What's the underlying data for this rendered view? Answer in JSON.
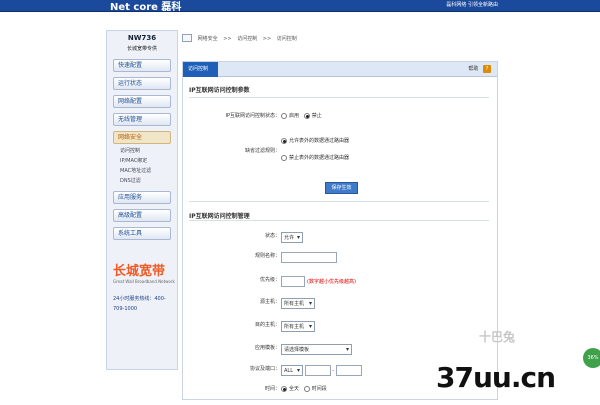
{
  "top": {
    "brand": "Net core 磊科",
    "slogan": "磊科网络 引领全新路由"
  },
  "sidebar": {
    "model": "NW736",
    "subtitle": "长城宽带专供",
    "items": [
      {
        "label": "快速配置"
      },
      {
        "label": "运行状态"
      },
      {
        "label": "网络配置"
      },
      {
        "label": "无线管理"
      },
      {
        "label": "网络安全",
        "active": true
      },
      {
        "label": "应用服务"
      },
      {
        "label": "高级配置"
      },
      {
        "label": "系统工具"
      }
    ],
    "sub_items": [
      "访问控制",
      "IP/MAC绑定",
      "MAC地址过滤",
      "DNS过滤"
    ],
    "logo": {
      "name": "长城宽带",
      "subtitle": "Great Wall Broadband Network"
    },
    "hotline": "24小时服务热线：400-709-1000"
  },
  "breadcrumb": {
    "items": [
      "网络安全",
      ">>",
      "访问控制",
      ">>",
      "访问控制"
    ]
  },
  "panel": {
    "tab": "访问控制",
    "help": "帮助",
    "help_icon": "?",
    "section1": {
      "title": "IP互联网访问控制参数",
      "row1_label": "IP互联网访问控制状态：",
      "row1_options": [
        "启用",
        "禁止"
      ],
      "row2_label": "缺省过滤规则：",
      "row2_options": [
        "允许表外的数据通过路由器",
        "禁止表外的数据通过路由器"
      ],
      "save_button": "保存生效"
    },
    "section2": {
      "title": "IP互联网访问控制管理",
      "state_label": "状态：",
      "state_value": "允许",
      "rule_name_label": "规则名称：",
      "rule_name_value": "",
      "priority_label": "优先级：",
      "priority_value": "",
      "priority_note": "(数字越小优先级越高)",
      "src_host_label": "源主机：",
      "src_host_value": "所有主机",
      "dst_host_label": "目的主机：",
      "dst_host_value": "所有主机",
      "template_label": "应用模板：",
      "template_value": "请选择模板",
      "proto_port_label": "协议及端口：",
      "proto_value": "ALL",
      "port_start": "",
      "port_sep": "-",
      "port_end": "",
      "time_label": "时间：",
      "time_options": [
        "全天",
        "时间段"
      ]
    }
  },
  "watermark": {
    "text": "37uu.cn",
    "logo": "十巴兔",
    "badge": "36%"
  }
}
